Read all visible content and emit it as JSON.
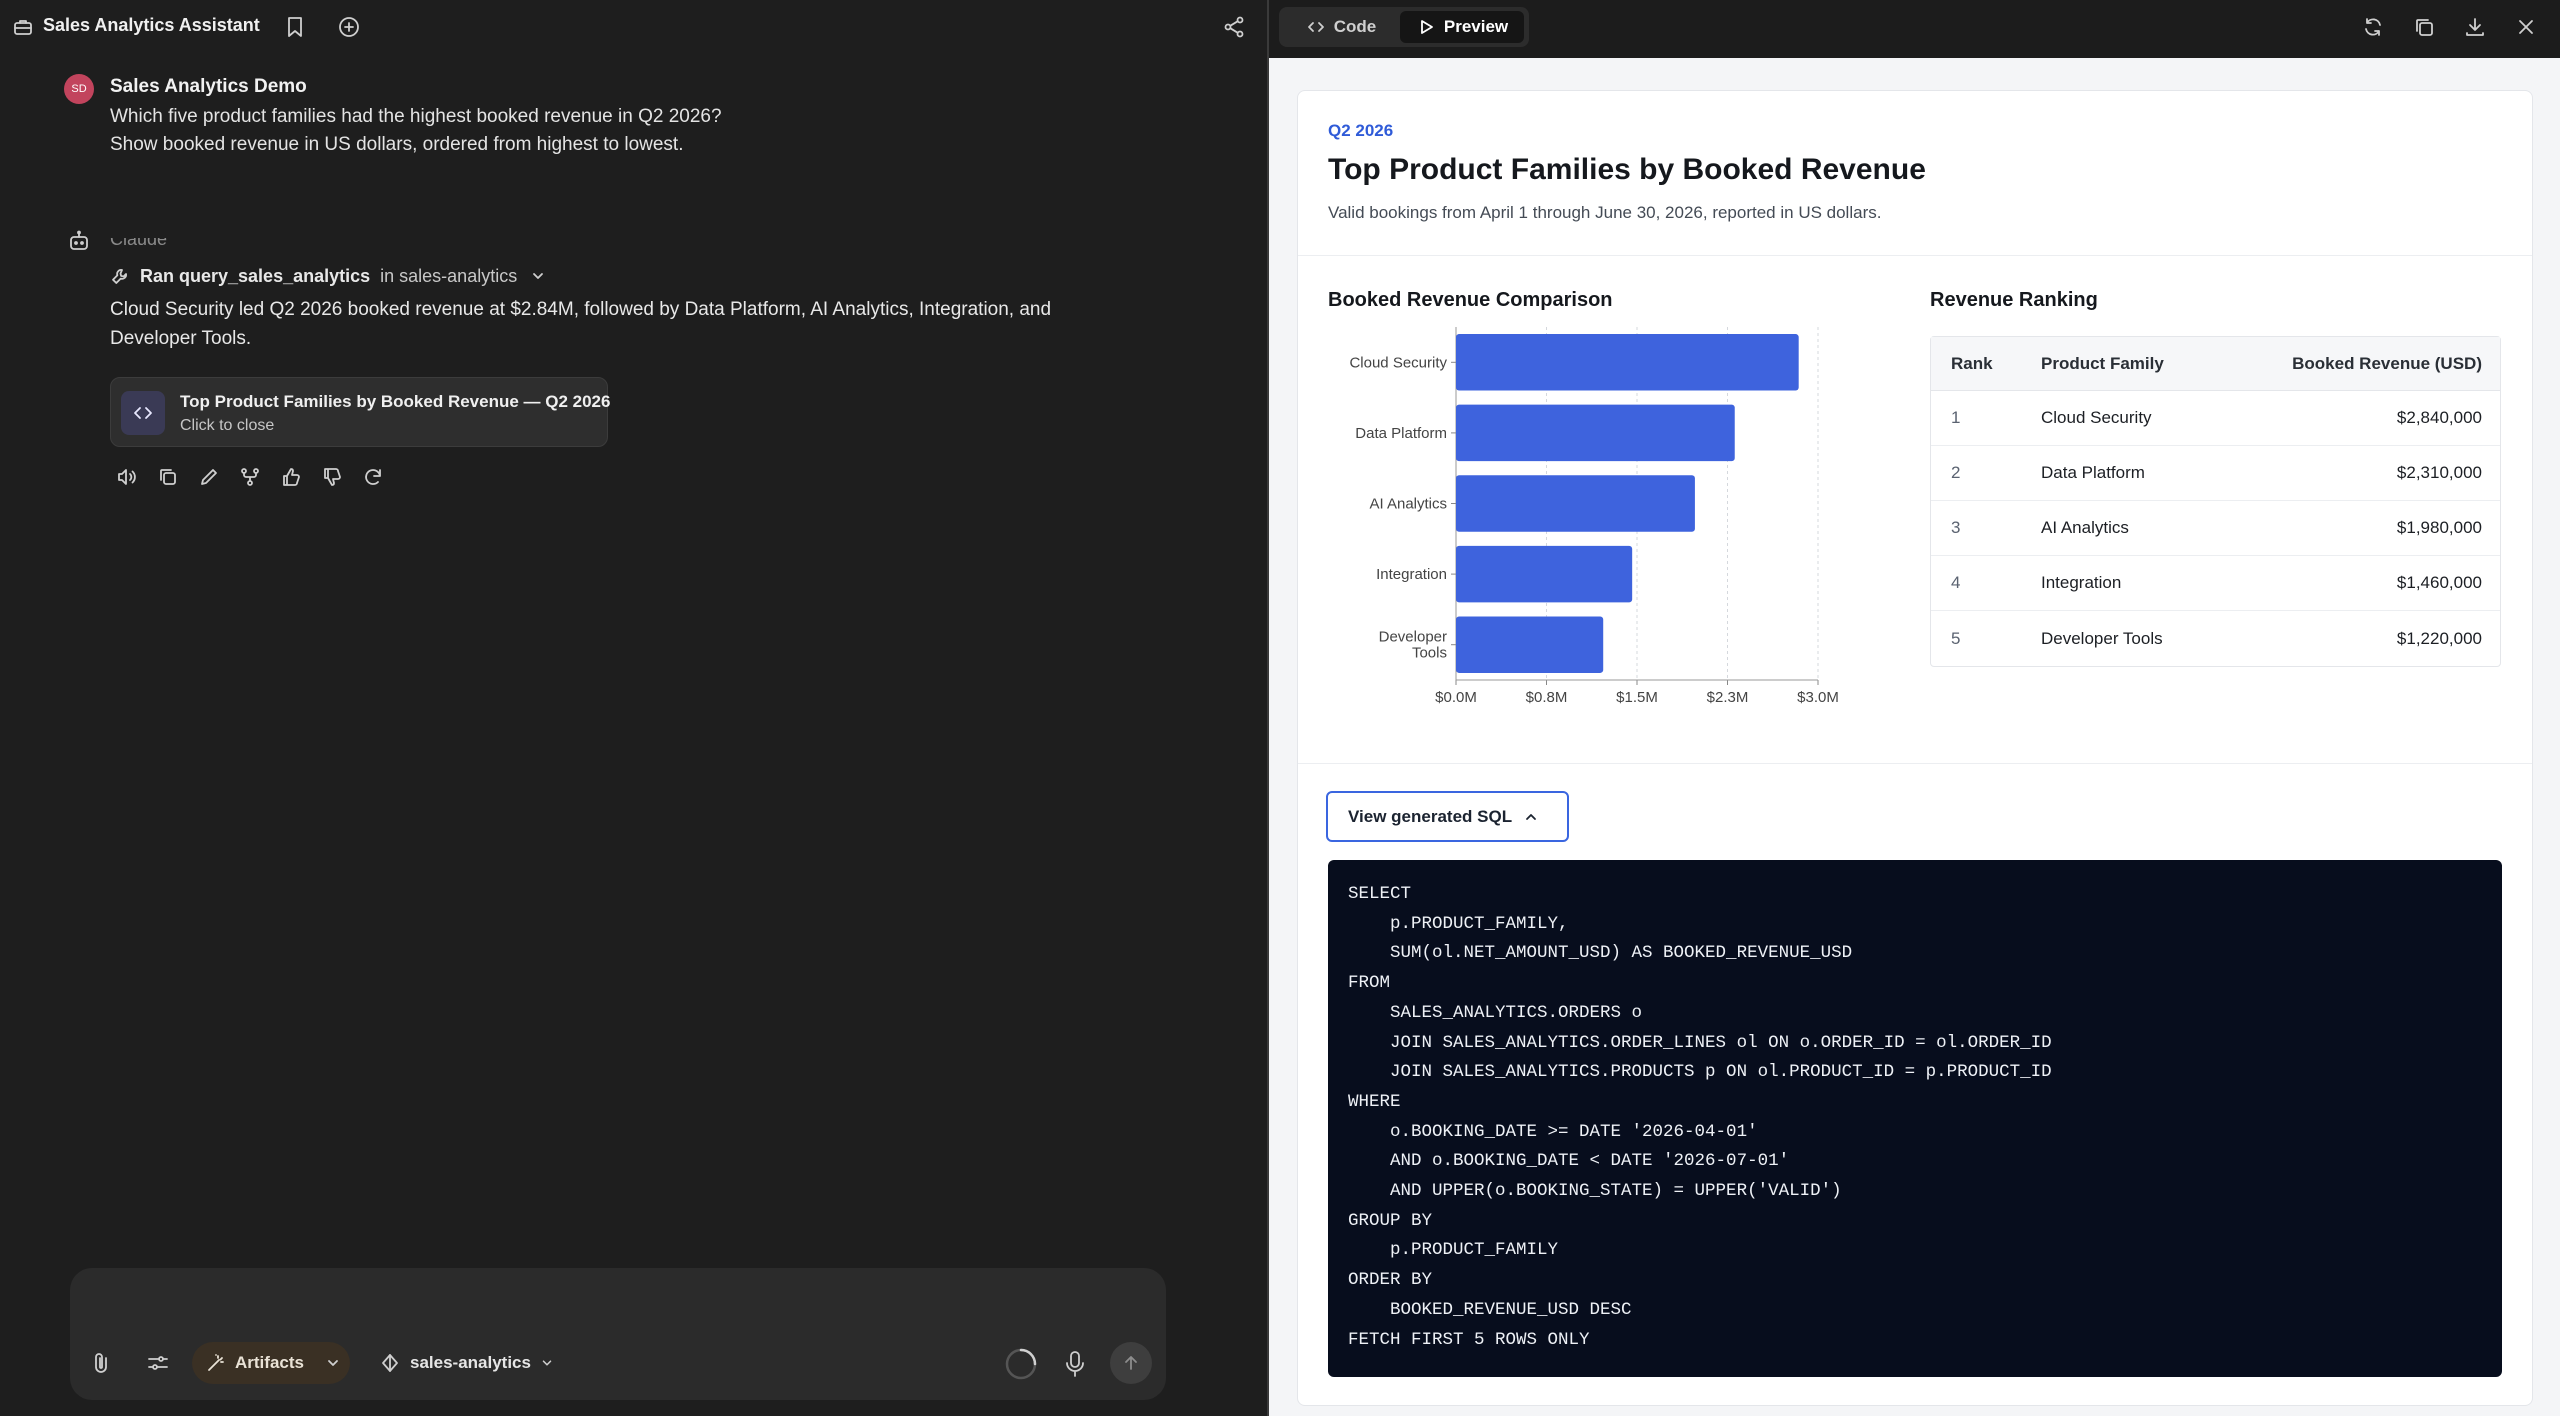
{
  "left_header": {
    "app_title": "Sales Analytics Assistant",
    "icons": [
      "bookmark-icon",
      "plus-circle-icon",
      "share-icon"
    ]
  },
  "user_message": {
    "avatar_initials": "SD",
    "avatar_color": "#c2445d",
    "name": "Sales Analytics Demo",
    "line1": "Which five product families had the highest booked revenue in Q2 2026?",
    "line2": "Show booked revenue in US dollars, ordered from highest to lowest."
  },
  "assistant": {
    "tool_name": "Ran query_sales_analytics",
    "tool_scope": "in sales-analytics",
    "reply_line1": "Cloud Security led Q2 2026 booked revenue at $2.84M, followed by Data Platform, AI Analytics, Integration, and",
    "reply_line2": "Developer Tools.",
    "artifact_title": "Top Product Families by Booked Revenue — Q2 2026",
    "artifact_subtitle": "Click to close",
    "actions": [
      "speaker-icon",
      "copy-icon",
      "edit-icon",
      "branch-icon",
      "thumbs-up-icon",
      "thumbs-down-icon",
      "retry-icon"
    ]
  },
  "composer": {
    "artifacts_label": "Artifacts",
    "source_label": "sales-analytics",
    "accent": "#3a3024"
  },
  "preview_toolbar": {
    "code_tab": "Code",
    "preview_tab": "Preview",
    "active_tab": "Preview"
  },
  "report": {
    "eyebrow": "Q2 2026",
    "title": "Top Product Families by Booked Revenue",
    "subtitle": "Valid bookings from April 1 through June 30, 2026, reported in US dollars.",
    "chart_heading": "Booked Revenue Comparison",
    "ranking_heading": "Revenue Ranking",
    "table": {
      "headers": [
        "Rank",
        "Product Family",
        "Booked Revenue (USD)"
      ],
      "rows": [
        [
          "1",
          "Cloud Security",
          "$2,840,000"
        ],
        [
          "2",
          "Data Platform",
          "$2,310,000"
        ],
        [
          "3",
          "AI Analytics",
          "$1,980,000"
        ],
        [
          "4",
          "Integration",
          "$1,460,000"
        ],
        [
          "5",
          "Developer Tools",
          "$1,220,000"
        ]
      ]
    },
    "sql_toggle_label": "View generated SQL",
    "sql": "SELECT\n    p.PRODUCT_FAMILY,\n    SUM(ol.NET_AMOUNT_USD) AS BOOKED_REVENUE_USD\nFROM\n    SALES_ANALYTICS.ORDERS o\n    JOIN SALES_ANALYTICS.ORDER_LINES ol ON o.ORDER_ID = ol.ORDER_ID\n    JOIN SALES_ANALYTICS.PRODUCTS p ON ol.PRODUCT_ID = p.PRODUCT_ID\nWHERE\n    o.BOOKING_DATE >= DATE '2026-04-01'\n    AND o.BOOKING_DATE < DATE '2026-07-01'\n    AND UPPER(o.BOOKING_STATE) = UPPER('VALID')\nGROUP BY\n    p.PRODUCT_FAMILY\nORDER BY\n    BOOKED_REVENUE_USD DESC\nFETCH FIRST 5 ROWS ONLY"
  },
  "chart_data": {
    "type": "bar",
    "orientation": "horizontal",
    "title": "Booked Revenue Comparison",
    "categories": [
      "Cloud Security",
      "Data Platform",
      "AI Analytics",
      "Integration",
      "Developer Tools"
    ],
    "values": [
      2840000,
      2310000,
      1980000,
      1460000,
      1220000
    ],
    "x_ticks": [
      "$0.0M",
      "$0.8M",
      "$1.5M",
      "$2.3M",
      "$3.0M"
    ],
    "xlim": [
      0,
      3000000
    ],
    "grid": true,
    "bar_color": "#3e63dd"
  }
}
